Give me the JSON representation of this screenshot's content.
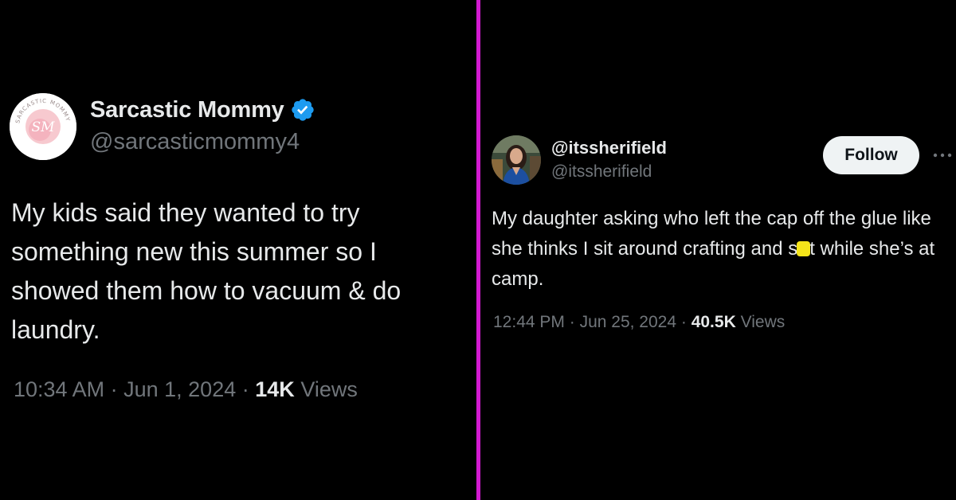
{
  "colors": {
    "background": "#000000",
    "divider": "#d21bd1",
    "primary_text": "#e7e9ea",
    "secondary_text": "#71767b",
    "verified_badge": "#1d9bf0",
    "follow_button_bg": "#eff3f4",
    "censor_mark": "#f5e51a"
  },
  "left_tweet": {
    "avatar_icon": "sarcastic-mommy-logo",
    "avatar_logo_initials": "SM",
    "avatar_logo_ring_text": "SARCASTIC MOMMY",
    "display_name": "Sarcastic Mommy",
    "verified_icon": "verified-badge-icon",
    "handle": "@sarcasticmommy4",
    "text": "My kids said they wanted to try something new this summer so I showed them how to vacuum & do laundry.",
    "time": "10:34 AM",
    "date": "Jun 1, 2024",
    "separator": "·",
    "views_count": "14K",
    "views_label": "Views"
  },
  "right_tweet": {
    "avatar_icon": "profile-photo",
    "display_name": "@itssherifield",
    "handle": "@itssherifield",
    "follow_label": "Follow",
    "more_icon": "more-options-icon",
    "text_before_censor": "My daughter asking who left the cap off the glue like she thinks I sit around crafting and s",
    "text_after_censor": "t while she’s at camp.",
    "time": "12:44 PM",
    "date": "Jun 25, 2024",
    "separator": "·",
    "views_count": "40.5K",
    "views_label": "Views"
  }
}
